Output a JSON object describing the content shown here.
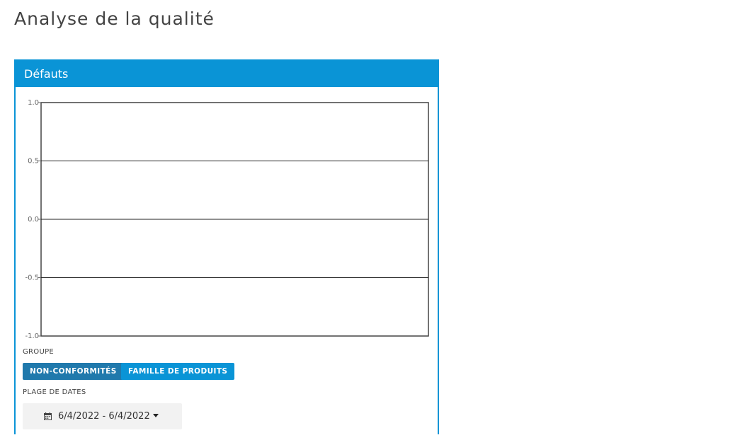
{
  "page": {
    "title": "Analyse de la qualité"
  },
  "panel": {
    "title": "Défauts"
  },
  "chart_data": {
    "type": "line",
    "title": "",
    "xlabel": "",
    "ylabel": "",
    "y_ticks": [
      "1.0",
      "0.5",
      "0.0",
      "-0.5",
      "-1.0"
    ],
    "ylim": [
      -1.0,
      1.0
    ],
    "series": [],
    "grid": true
  },
  "groupe": {
    "label": "GROUPE",
    "buttons": [
      "NON-CONFORMITÉS",
      "FAMILLE DE PRODUITS"
    ]
  },
  "plage": {
    "label": "PLAGE DE DATES",
    "value": "6/4/2022 - 6/4/2022"
  },
  "colors": {
    "accent": "#0a94d6",
    "active_button": "#2079ac"
  }
}
